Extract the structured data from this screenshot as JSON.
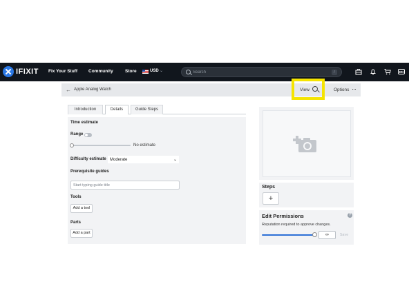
{
  "nav": {
    "logo": "IFIXIT",
    "links": [
      "Fix Your Stuff",
      "Community",
      "Store"
    ],
    "currency": "USD",
    "search_placeholder": "Search",
    "search_shortcut": "/",
    "language": "EN"
  },
  "header": {
    "breadcrumb_title": "Apple Analog Watch",
    "view_label": "View",
    "options_label": "Options",
    "options_icon": "···"
  },
  "tabs": [
    "Introduction",
    "Details",
    "Guide Steps"
  ],
  "active_tab": "Details",
  "details": {
    "time_estimate_label": "Time estimate",
    "range_label": "Range",
    "time_value": "No estimate",
    "difficulty_label": "Difficulty estimate",
    "difficulty_value": "Moderate",
    "prereq_label": "Prerequisite guides",
    "prereq_placeholder": "Start typing guide title",
    "tools_label": "Tools",
    "add_tool": "Add a tool",
    "parts_label": "Parts",
    "add_part": "Add a part"
  },
  "sidebar": {
    "steps_title": "Steps",
    "add_step": "+",
    "permissions_title": "Edit Permissions",
    "permissions_help": "?",
    "permissions_desc": "Reputation required to approve changes.",
    "permissions_value": "∞",
    "save_label": "Save"
  },
  "colors": {
    "nav_bg": "#11161d",
    "highlight": "#f5e400",
    "accent_blue": "#2b6fd6"
  }
}
